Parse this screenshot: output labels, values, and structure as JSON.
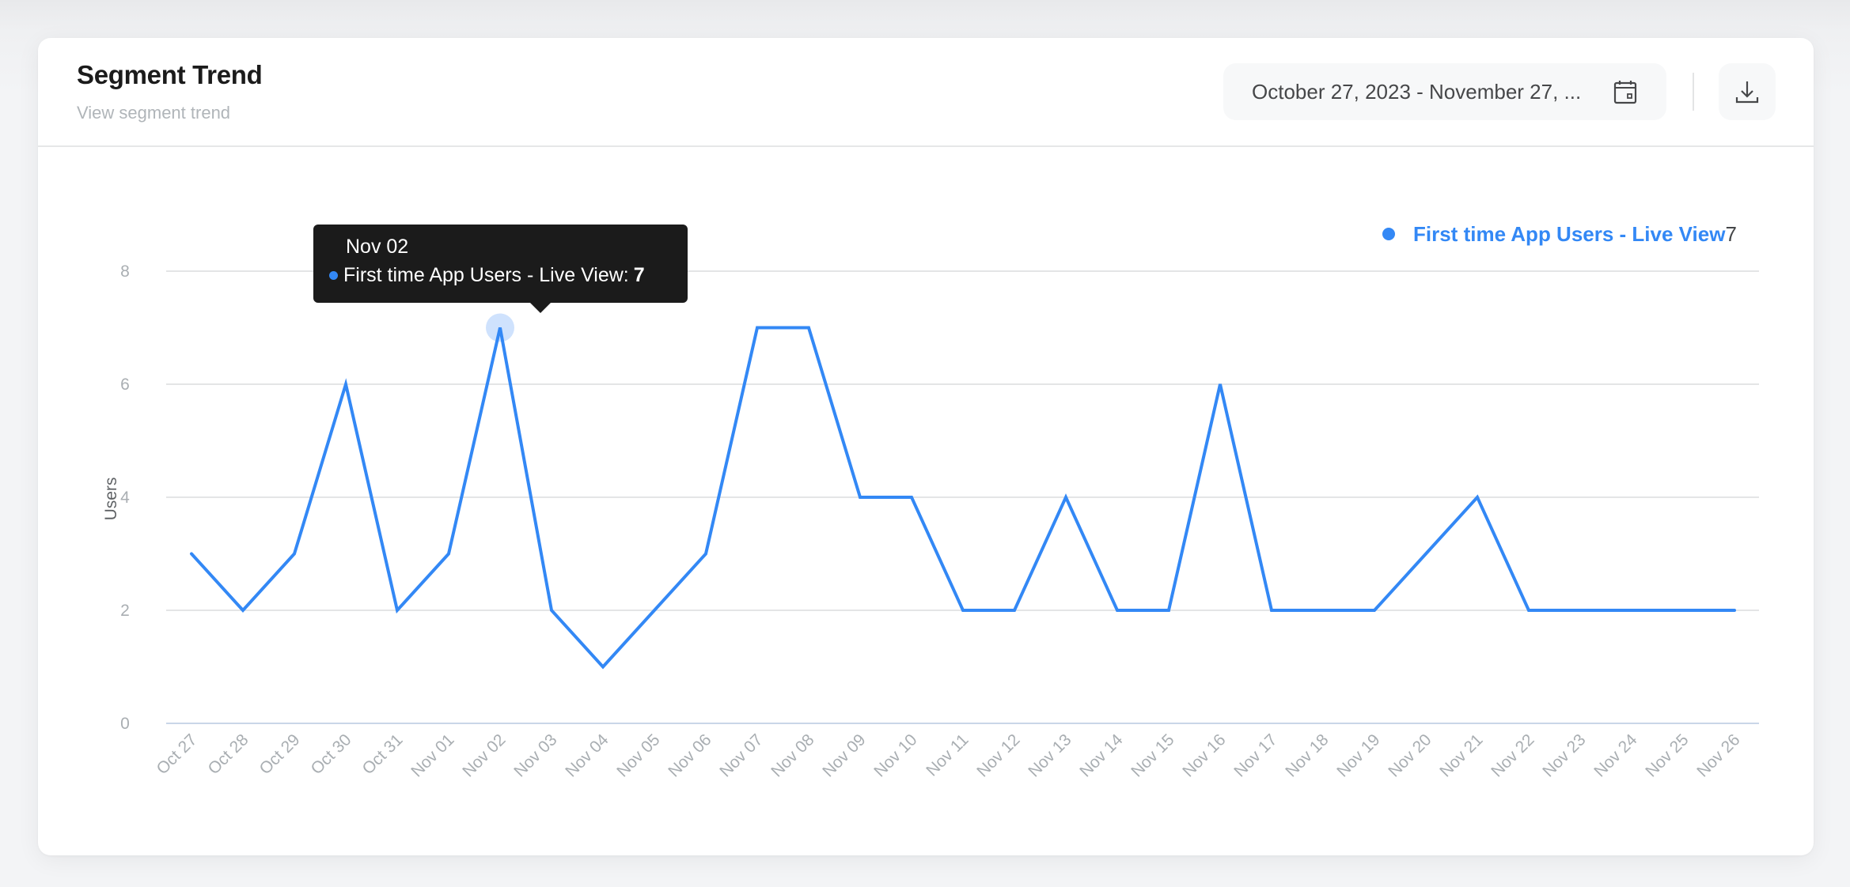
{
  "header": {
    "title": "Segment Trend",
    "subtitle": "View segment trend",
    "date_range": "October 27, 2023 - November 27, ...",
    "date_icon": "calendar-icon",
    "download_icon": "download-icon"
  },
  "colors": {
    "series": "#3388f5",
    "halo": "#cfe2fd",
    "grid": "#e4e5e6",
    "baseline": "#c9d6e8",
    "tooltip_bg": "#1b1b1b"
  },
  "tooltip": {
    "date": "Nov 02",
    "series": "First time App Users - Live View:",
    "value": "7",
    "index": 6
  },
  "chart_data": {
    "type": "line",
    "title": "",
    "xlabel": "",
    "ylabel": "Users",
    "ylim": [
      0,
      8
    ],
    "yticks": [
      0,
      2,
      4,
      6,
      8
    ],
    "grid": true,
    "legend": {
      "position": "top-right",
      "label": "First time App Users - Live View",
      "value": "7"
    },
    "categories": [
      "Oct 27",
      "Oct 28",
      "Oct 29",
      "Oct 30",
      "Oct 31",
      "Nov 01",
      "Nov 02",
      "Nov 03",
      "Nov 04",
      "Nov 05",
      "Nov 06",
      "Nov 07",
      "Nov 08",
      "Nov 09",
      "Nov 10",
      "Nov 11",
      "Nov 12",
      "Nov 13",
      "Nov 14",
      "Nov 15",
      "Nov 16",
      "Nov 17",
      "Nov 18",
      "Nov 19",
      "Nov 20",
      "Nov 21",
      "Nov 22",
      "Nov 23",
      "Nov 24",
      "Nov 25",
      "Nov 26"
    ],
    "series": [
      {
        "name": "First time App Users - Live View",
        "values": [
          3,
          2,
          3,
          6,
          2,
          3,
          7,
          2,
          1,
          2,
          3,
          7,
          7,
          4,
          4,
          2,
          2,
          4,
          2,
          2,
          6,
          2,
          2,
          2,
          3,
          4,
          2,
          2,
          2,
          2,
          2
        ]
      }
    ]
  }
}
